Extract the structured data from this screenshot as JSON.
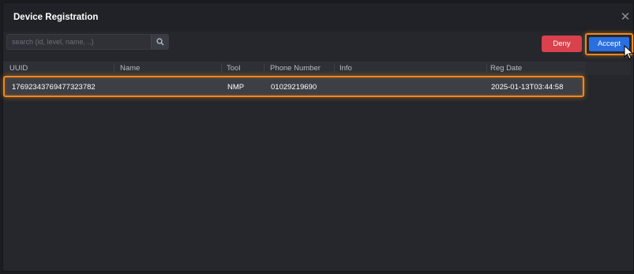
{
  "dialog": {
    "title": "Device Registration",
    "close_icon": "close-icon"
  },
  "search": {
    "placeholder": "search (id, level, name, ..)",
    "value": "",
    "icon": "search-icon"
  },
  "actions": {
    "deny_label": "Deny",
    "accept_label": "Accept",
    "deny_color": "#d9414d",
    "accept_color": "#2a6fe0",
    "highlight_color": "#f0881c"
  },
  "table": {
    "columns": {
      "uuid": "UUID",
      "name": "Name",
      "tool": "Tool",
      "phone": "Phone Number",
      "info": "Info",
      "reg_date": "Reg Date"
    },
    "rows": [
      {
        "uuid": "17692343769477323782",
        "name": "",
        "tool": "NMP",
        "phone": "01029219690",
        "info": "",
        "reg_date": "2025-01-13T03:44:58"
      }
    ]
  }
}
